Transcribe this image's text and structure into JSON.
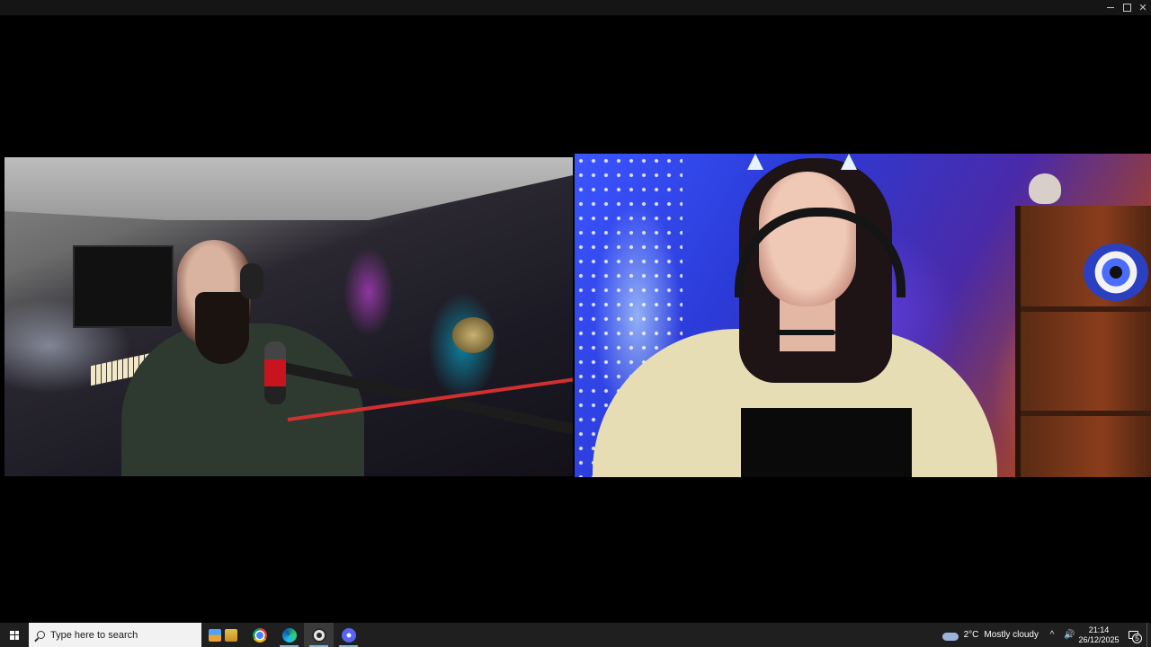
{
  "window": {
    "controls": {
      "minimize": "–",
      "maximize": "□",
      "close": "✕"
    }
  },
  "videos": [
    {
      "id": "participant-left",
      "content": "webcam feed"
    },
    {
      "id": "participant-right",
      "content": "webcam feed"
    }
  ],
  "taskbar": {
    "search_placeholder": "Type here to search",
    "pinned_apps": [
      "news-and-interests",
      "chrome",
      "edge",
      "obs",
      "discord"
    ],
    "weather": {
      "temperature": "2°C",
      "condition": "Mostly cloudy"
    },
    "tray": {
      "chevron": "^",
      "volume": "🔊"
    },
    "clock": {
      "time": "21:14",
      "date": "26/12/2025"
    },
    "notifications": {
      "count": "5"
    }
  },
  "colors": {
    "taskbar_bg": "#1f1f1f",
    "search_bg": "#f2f2f2",
    "active_indicator": "#7ab0e8"
  }
}
